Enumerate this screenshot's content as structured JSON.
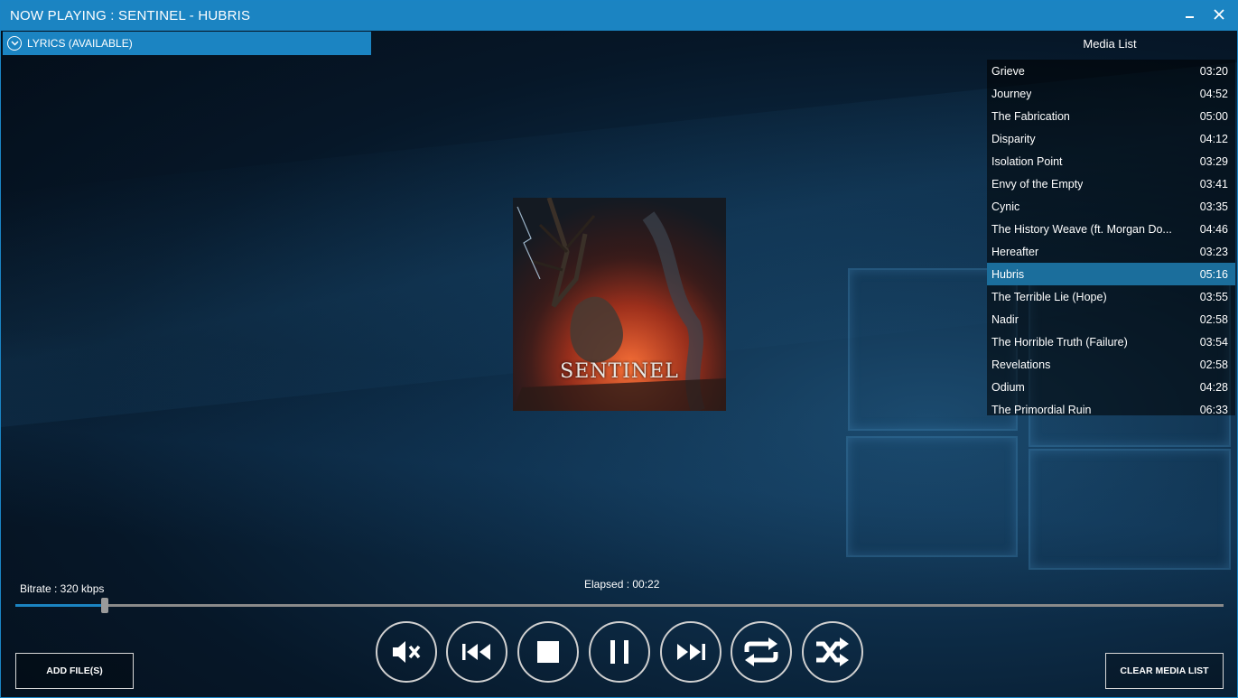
{
  "window": {
    "title": "NOW PLAYING : SENTINEL - HUBRIS",
    "accent": "#1b84c2"
  },
  "lyrics": {
    "label": "LYRICS (AVAILABLE)",
    "icon": "chevron-down-circle-icon"
  },
  "album_art": {
    "text": "SENTINEL"
  },
  "media_list": {
    "title": "Media List",
    "items": [
      {
        "title": "Grieve",
        "duration": "03:20"
      },
      {
        "title": "Journey",
        "duration": "04:52"
      },
      {
        "title": "The Fabrication",
        "duration": "05:00"
      },
      {
        "title": "Disparity",
        "duration": "04:12"
      },
      {
        "title": "Isolation Point",
        "duration": "03:29"
      },
      {
        "title": "Envy of the Empty",
        "duration": "03:41"
      },
      {
        "title": "Cynic",
        "duration": "03:35"
      },
      {
        "title": "The History Weave (ft. Morgan Do...",
        "duration": "04:46"
      },
      {
        "title": "Hereafter",
        "duration": "03:23"
      },
      {
        "title": "Hubris",
        "duration": "05:16",
        "selected": true
      },
      {
        "title": "The Terrible Lie (Hope)",
        "duration": "03:55"
      },
      {
        "title": "Nadir",
        "duration": "02:58"
      },
      {
        "title": "The Horrible Truth (Failure)",
        "duration": "03:54"
      },
      {
        "title": "Revelations",
        "duration": "02:58"
      },
      {
        "title": "Odium",
        "duration": "04:28"
      },
      {
        "title": "The Primordial Ruin",
        "duration": "06:33"
      }
    ]
  },
  "status": {
    "bitrate": "Bitrate : 320 kbps",
    "elapsed": "Elapsed : 00:22"
  },
  "seek": {
    "progress": 0.074
  },
  "controls": {
    "mute_icon": "mute-icon",
    "previous_icon": "previous-icon",
    "stop_icon": "stop-icon",
    "pause_icon": "pause-icon",
    "next_icon": "next-icon",
    "repeat_icon": "repeat-icon",
    "shuffle_icon": "shuffle-icon"
  },
  "buttons": {
    "add_files": "ADD FILE(S)",
    "clear_media_list": "CLEAR MEDIA LIST"
  }
}
